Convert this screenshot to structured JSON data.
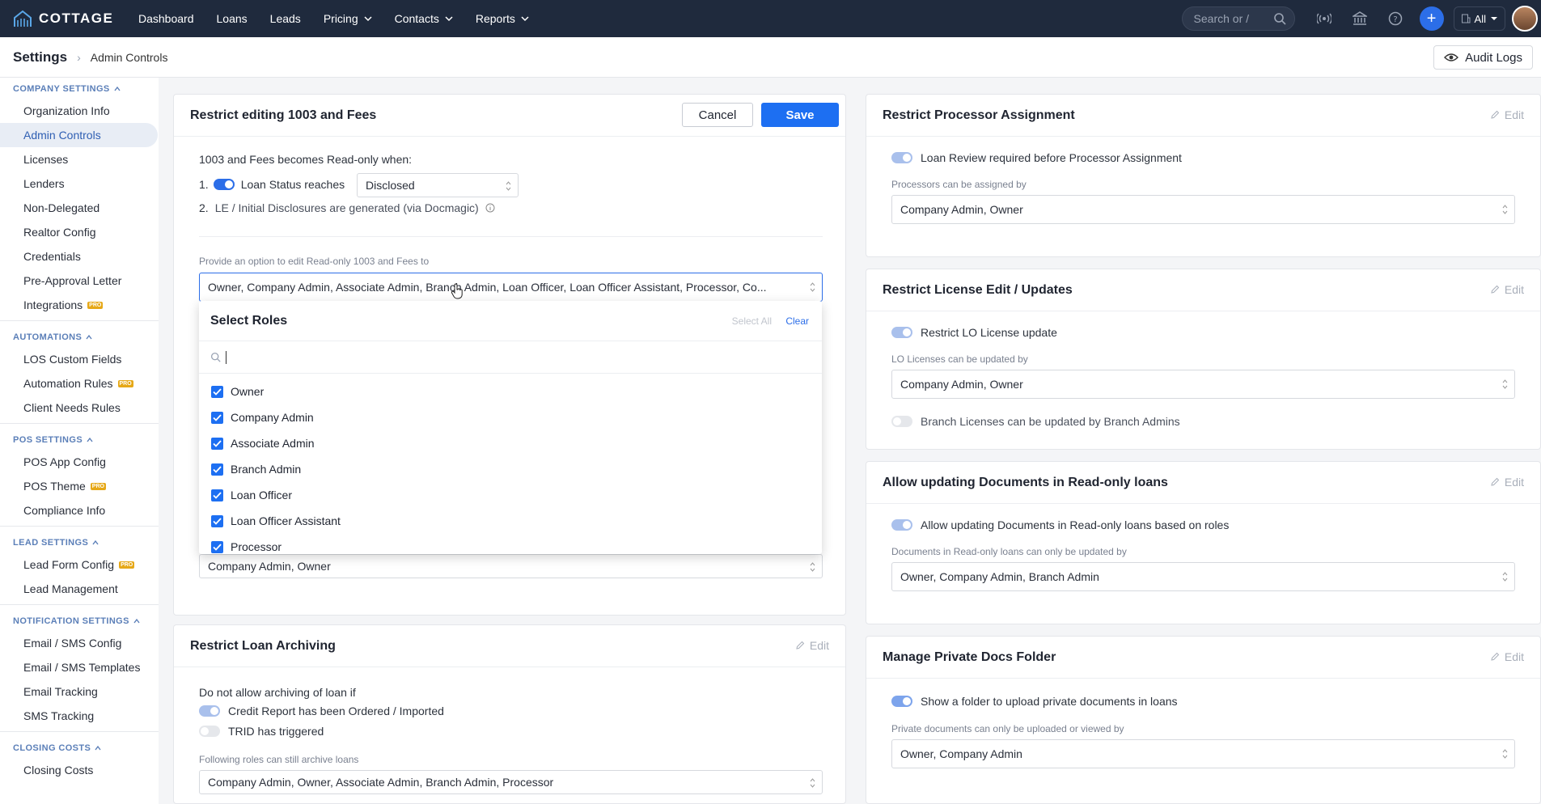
{
  "brand": {
    "name": "COTTAGE"
  },
  "nav": {
    "items": [
      "Dashboard",
      "Loans",
      "Leads",
      "Pricing",
      "Contacts",
      "Reports"
    ],
    "search_placeholder": "Search or /",
    "scope": "All"
  },
  "header": {
    "breadcrumb_root": "Settings",
    "breadcrumb_current": "Admin Controls",
    "audit_logs": "Audit Logs"
  },
  "sidebar": {
    "groups": [
      {
        "title": "COMPANY SETTINGS",
        "items": [
          {
            "label": "Organization Info"
          },
          {
            "label": "Admin Controls",
            "active": true
          },
          {
            "label": "Licenses"
          },
          {
            "label": "Lenders"
          },
          {
            "label": "Non-Delegated"
          },
          {
            "label": "Realtor Config"
          },
          {
            "label": "Credentials"
          },
          {
            "label": "Pre-Approval Letter"
          },
          {
            "label": "Integrations",
            "pro": true
          }
        ]
      },
      {
        "title": "AUTOMATIONS",
        "items": [
          {
            "label": "LOS Custom Fields"
          },
          {
            "label": "Automation Rules",
            "pro": true
          },
          {
            "label": "Client Needs Rules"
          }
        ]
      },
      {
        "title": "POS SETTINGS",
        "items": [
          {
            "label": "POS App Config"
          },
          {
            "label": "POS Theme",
            "pro": true
          },
          {
            "label": "Compliance Info"
          }
        ]
      },
      {
        "title": "LEAD SETTINGS",
        "items": [
          {
            "label": "Lead Form Config",
            "pro": true
          },
          {
            "label": "Lead Management"
          }
        ]
      },
      {
        "title": "NOTIFICATION SETTINGS",
        "items": [
          {
            "label": "Email / SMS Config"
          },
          {
            "label": "Email / SMS Templates"
          },
          {
            "label": "Email Tracking"
          },
          {
            "label": "SMS Tracking"
          }
        ]
      },
      {
        "title": "CLOSING COSTS",
        "items": [
          {
            "label": "Closing Costs"
          }
        ]
      }
    ],
    "pro_badge": "PRO"
  },
  "card_1003": {
    "title": "Restrict editing 1003 and Fees",
    "cancel": "Cancel",
    "save": "Save",
    "readonly_when": "1003 and Fees becomes Read-only when:",
    "cond1_num": "1.",
    "cond1_label": "Loan Status reaches",
    "cond1_value": "Disclosed",
    "cond2_num": "2.",
    "cond2_label": "LE / Initial Disclosures are generated (via Docmagic)",
    "edit_option_label": "Provide an option to edit Read-only 1003 and Fees to",
    "edit_option_value": "Owner, Company Admin, Associate Admin, Branch Admin, Loan Officer, Loan Officer Assistant, Processor, Co...",
    "hidden_value": "Company Admin, Owner"
  },
  "dropdown": {
    "title": "Select Roles",
    "select_all": "Select All",
    "clear": "Clear",
    "options": [
      "Owner",
      "Company Admin",
      "Associate Admin",
      "Branch Admin",
      "Loan Officer",
      "Loan Officer Assistant",
      "Processor"
    ]
  },
  "card_archive": {
    "title": "Restrict Loan Archiving",
    "edit": "Edit",
    "intro": "Do not allow archiving of loan if",
    "opt1": "Credit Report has been Ordered / Imported",
    "opt2": "TRID has triggered",
    "roles_label": "Following roles can still archive loans",
    "roles_value": "Company Admin, Owner, Associate Admin, Branch Admin, Processor"
  },
  "card_processor": {
    "title": "Restrict Processor Assignment",
    "edit": "Edit",
    "toggle_label": "Loan Review required before Processor Assignment",
    "field_label": "Processors can be assigned by",
    "field_value": "Company Admin, Owner"
  },
  "card_license": {
    "title": "Restrict License Edit / Updates",
    "edit": "Edit",
    "toggle1": "Restrict LO License update",
    "field_label": "LO Licenses can be updated by",
    "field_value": "Company Admin, Owner",
    "toggle2": "Branch Licenses can be updated by Branch Admins"
  },
  "card_documents": {
    "title": "Allow updating Documents in Read-only loans",
    "edit": "Edit",
    "toggle_label": "Allow updating Documents in Read-only loans based on roles",
    "field_label": "Documents in Read-only loans can only be updated by",
    "field_value": "Owner, Company Admin, Branch Admin"
  },
  "card_private": {
    "title": "Manage Private Docs Folder",
    "edit": "Edit",
    "toggle_label": "Show a folder to upload private documents in loans",
    "field_label": "Private documents can only be uploaded or viewed by",
    "field_value": "Owner, Company Admin"
  },
  "colors": {
    "nav_bg": "#1f2a3d",
    "accent": "#1d6ff2",
    "pro": "#e6a817"
  }
}
